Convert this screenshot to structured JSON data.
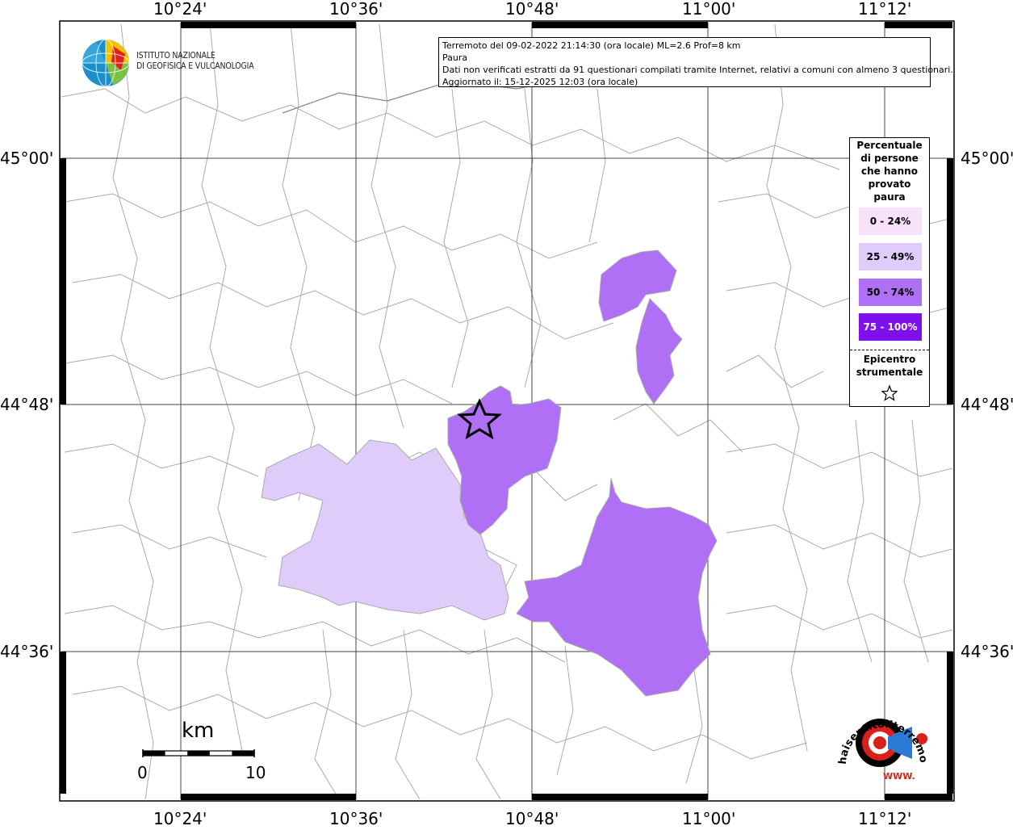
{
  "map": {
    "top_ticks": [
      "10°24'",
      "10°36'",
      "10°48'",
      "11°00'",
      "11°12'"
    ],
    "bottom_ticks": [
      "10°24'",
      "10°36'",
      "10°48'",
      "11°00'",
      "11°12'"
    ],
    "left_ticks": [
      "45°00'",
      "44°48'",
      "44°36'"
    ],
    "right_ticks": [
      "45°00'",
      "44°48'",
      "44°36'"
    ]
  },
  "info": {
    "line1": "Terremoto del 09-02-2022 21:14:30 (ora locale) ML=2.6 Prof=8 km",
    "line2": "Paura",
    "line3": "Dati non verificati estratti da 91 questionari compilati tramite Internet, relativi a comuni con almeno 3 questionari.",
    "line4": "Aggiornato il: 15-12-2025 12:03 (ora locale)"
  },
  "logo": {
    "line1": "ISTITUTO NAZIONALE",
    "line2": "DI GEOFISICA E VULCANOLOGIA"
  },
  "legend": {
    "title_lines": [
      "Percentuale",
      "di persone",
      "che hanno",
      "provato",
      "paura"
    ],
    "items": [
      {
        "label": "0 - 24%",
        "color": "#f9e0fb",
        "text_color": "#000000"
      },
      {
        "label": "25 - 49%",
        "color": "#e0ccfb",
        "text_color": "#000000"
      },
      {
        "label": "50 - 74%",
        "color": "#b070f5",
        "text_color": "#000000"
      },
      {
        "label": "75 - 100%",
        "color": "#7f10ee",
        "text_color": "#ffffff"
      }
    ],
    "epicenter_lines": [
      "Epicentro",
      "strumentale"
    ]
  },
  "scale": {
    "unit": "km",
    "start": "0",
    "end": "10"
  },
  "site_logo": {
    "text": "haisentitoilterremoto.it",
    "url_text": "WWW."
  },
  "colors": {
    "class_25_49": "#e0ccfb",
    "class_50_74": "#b070f5",
    "border": "#aaaaaa"
  }
}
